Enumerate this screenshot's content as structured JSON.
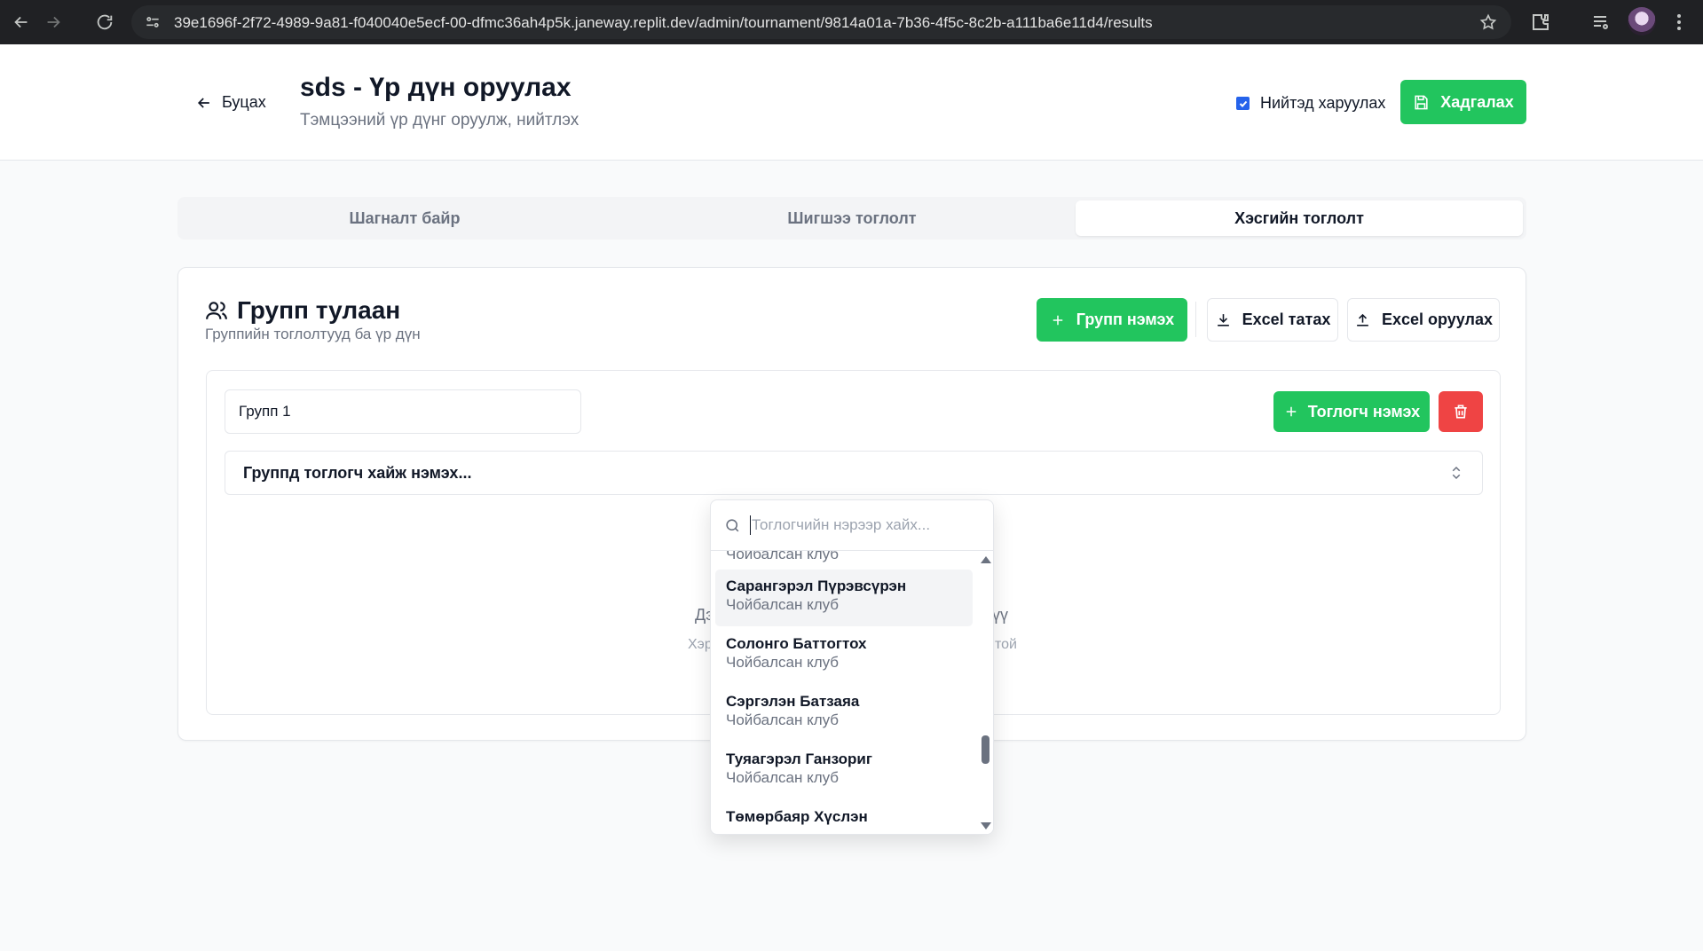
{
  "browser": {
    "url": "39e1696f-2f72-4989-9a81-f040040e5ecf-00-dfmc36ah4p5k.janeway.replit.dev/admin/tournament/9814a01a-7b36-4f5c-8c2b-a111ba6e11d4/results"
  },
  "header": {
    "back_label": "Буцах",
    "title": "sds - Үр дүн оруулах",
    "subtitle": "Тэмцээний үр дүнг оруулж, нийтлэх",
    "publish_label": "Нийтэд харуулах",
    "publish_checked": true,
    "save_label": "Хадгалах"
  },
  "tabs": [
    {
      "label": "Шагналт байр",
      "active": false
    },
    {
      "label": "Шигшээ тоглолт",
      "active": false
    },
    {
      "label": "Хэсгийн тоглолт",
      "active": true
    }
  ],
  "card": {
    "title": "Групп тулаан",
    "subtitle": "Группийн тоглолтууд ба үр дүн",
    "add_group_label": "Групп нэмэх",
    "excel_download_label": "Excel татах",
    "excel_upload_label": "Excel оруулах"
  },
  "group": {
    "name_value": "Групп 1",
    "add_player_label": "Тоглогч нэмэх",
    "combo_label": "Группд тоглогч хайж нэмэх...",
    "empty_line1_left": "Дэ",
    "empty_line1_right": "үү",
    "empty_line2_left": "Хэр",
    "empty_line2_right": "той"
  },
  "player_search": {
    "placeholder": "Тоглогчийн нэрээр хайх...",
    "partial_top_club": "Чойбалсан клуб",
    "players": [
      {
        "name": "Сарангэрэл Пүрэвсүрэн",
        "club": "Чойбалсан клуб",
        "highlighted": true
      },
      {
        "name": "Солонго Баттогтох",
        "club": "Чойбалсан клуб",
        "highlighted": false
      },
      {
        "name": "Сэргэлэн Батзаяа",
        "club": "Чойбалсан клуб",
        "highlighted": false
      },
      {
        "name": "Туяагэрэл Ганзориг",
        "club": "Чойбалсан клуб",
        "highlighted": false
      },
      {
        "name": "Төмөрбаяр Хүслэн",
        "club": "",
        "highlighted": false
      }
    ]
  },
  "colors": {
    "primary_green": "#22c55e",
    "danger_red": "#ef4444",
    "checkbox_blue": "#2563eb"
  }
}
